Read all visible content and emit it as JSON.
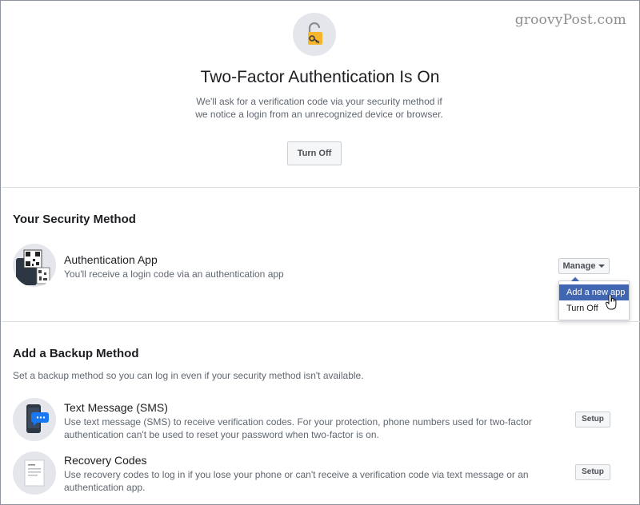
{
  "watermark": "groovyPost.com",
  "hero": {
    "icon": "lock-key-icon",
    "title": "Two-Factor Authentication Is On",
    "description": "We'll ask for a verification code via your security method if we notice a login from an unrecognized device or browser.",
    "turn_off_label": "Turn Off"
  },
  "security_method": {
    "heading": "Your Security Method",
    "method": {
      "icon": "qr-phone-icon",
      "name": "Authentication App",
      "description": "You'll receive a login code via an authentication app"
    },
    "manage_label": "Manage",
    "dropdown": {
      "items": [
        {
          "label": "Add a new app"
        },
        {
          "label": "Turn Off"
        }
      ]
    }
  },
  "backup_method": {
    "heading": "Add a Backup Method",
    "subtitle": "Set a backup method so you can log in even if your security method isn't available.",
    "methods": [
      {
        "icon": "sms-phone-icon",
        "name": "Text Message (SMS)",
        "description": "Use text message (SMS) to receive verification codes. For your protection, phone numbers used for two-factor authentication can't be used to reset your password when two-factor is on.",
        "setup_label": "Setup"
      },
      {
        "icon": "document-icon",
        "name": "Recovery Codes",
        "description": "Use recovery codes to log in if you lose your phone or can't receive a verification code via text message or an authentication app.",
        "setup_label": "Setup"
      }
    ]
  },
  "colors": {
    "accent": "#4267b2",
    "lock_yellow": "#f5b62e",
    "sms_blue": "#1877f2"
  }
}
